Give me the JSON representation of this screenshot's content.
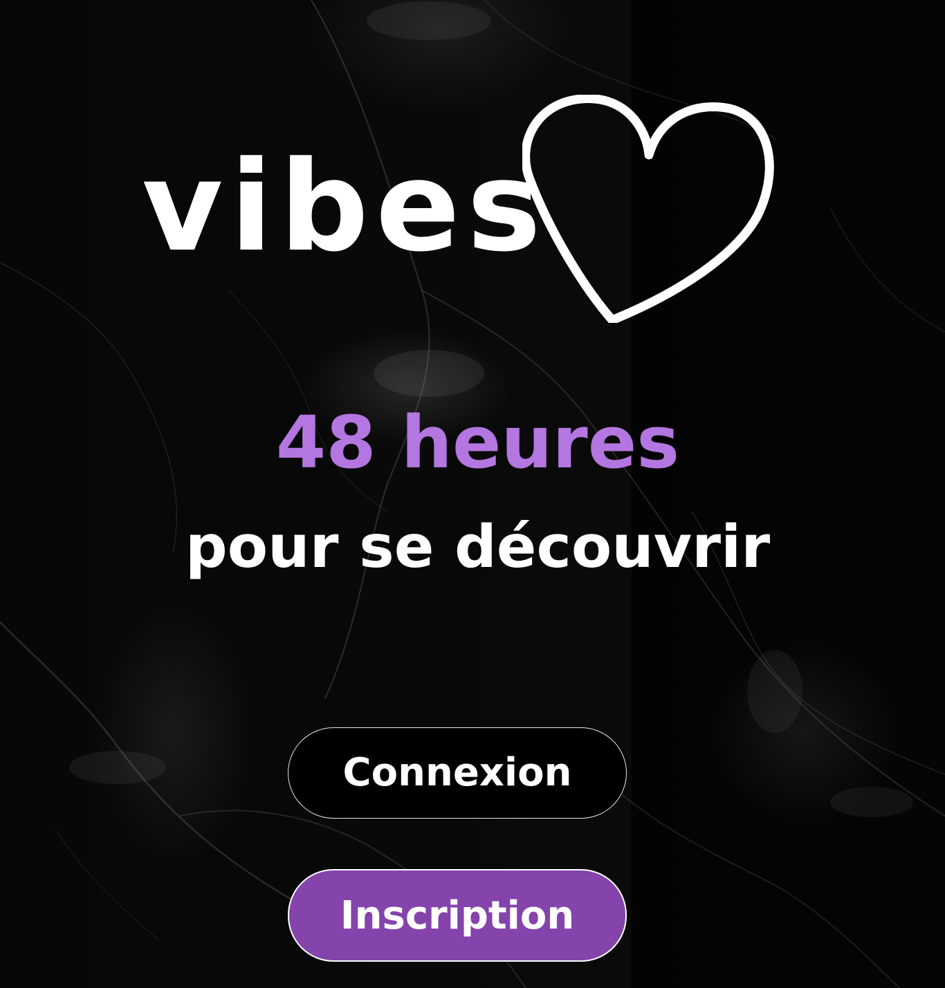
{
  "app": {
    "logo_text": "vibes",
    "logo_icon": "heart-outline-icon"
  },
  "hero": {
    "highlight": "48 heures",
    "subtitle": "pour se découvrir"
  },
  "actions": {
    "login_label": "Connexion",
    "signup_label": "Inscription"
  },
  "colors": {
    "background": "#050505",
    "accent_text": "#b476e0",
    "signup_button": "#8444ab",
    "text": "#ffffff"
  }
}
